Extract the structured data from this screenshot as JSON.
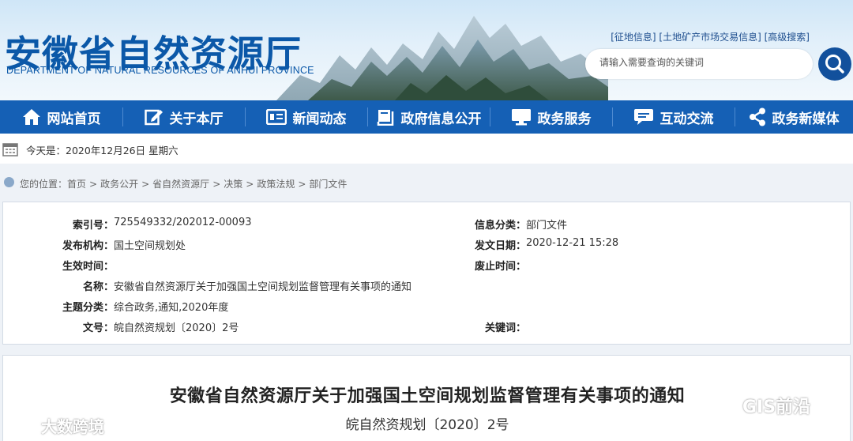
{
  "header": {
    "logo_cn": "安徽省自然资源厅",
    "logo_en": "DEPARTMENT OF NATURAL RESOURCES OF ANHUI PROVINCE",
    "links": [
      "[征地信息]",
      "[土地矿产市场交易信息]",
      "[高级搜索]"
    ],
    "search_placeholder": "请输入需要查询的关键词",
    "search_icon": "search-icon"
  },
  "nav": [
    {
      "label": "网站首页",
      "icon": "home-icon"
    },
    {
      "label": "关于本厅",
      "icon": "edit-icon"
    },
    {
      "label": "新闻动态",
      "icon": "news-icon"
    },
    {
      "label": "政府信息公开",
      "icon": "book-icon"
    },
    {
      "label": "政务服务",
      "icon": "monitor-icon"
    },
    {
      "label": "互动交流",
      "icon": "chat-icon"
    },
    {
      "label": "政务新媒体",
      "icon": "share-icon"
    }
  ],
  "datebar": {
    "text": "今天是：2020年12月26日 星期六",
    "icon": "calendar-icon"
  },
  "breadcrumb": {
    "prefix": "您的位置：",
    "items": [
      "首页",
      "政务公开",
      "省自然资源厅",
      "决策",
      "政策法规",
      "部门文件"
    ],
    "separator": ">"
  },
  "meta": {
    "index_no_label": "索引号：",
    "index_no": "725549332/202012-00093",
    "category_label": "信息分类：",
    "category": "部门文件",
    "publisher_label": "发布机构：",
    "publisher": "国土空间规划处",
    "issue_date_label": "发文日期：",
    "issue_date": "2020-12-21 15:28",
    "effective_label": "生效时间：",
    "effective": "",
    "repeal_label": "废止时间：",
    "repeal": "",
    "name_label": "名称：",
    "name": "安徽省自然资源厅关于加强国土空间规划监督管理有关事项的通知",
    "topic_label": "主题分类：",
    "topic": "综合政务,通知,2020年度",
    "doc_no_label": "文号：",
    "doc_no": "皖自然资规划〔2020〕2号",
    "keywords_label": "关键词：",
    "keywords": ""
  },
  "article": {
    "title": "安徽省自然资源厅关于加强国土空间规划监督管理有关事项的通知",
    "subtitle": "皖自然资规划〔2020〕2号"
  },
  "watermarks": {
    "left": "大数跨境",
    "right": "GIS前沿"
  }
}
